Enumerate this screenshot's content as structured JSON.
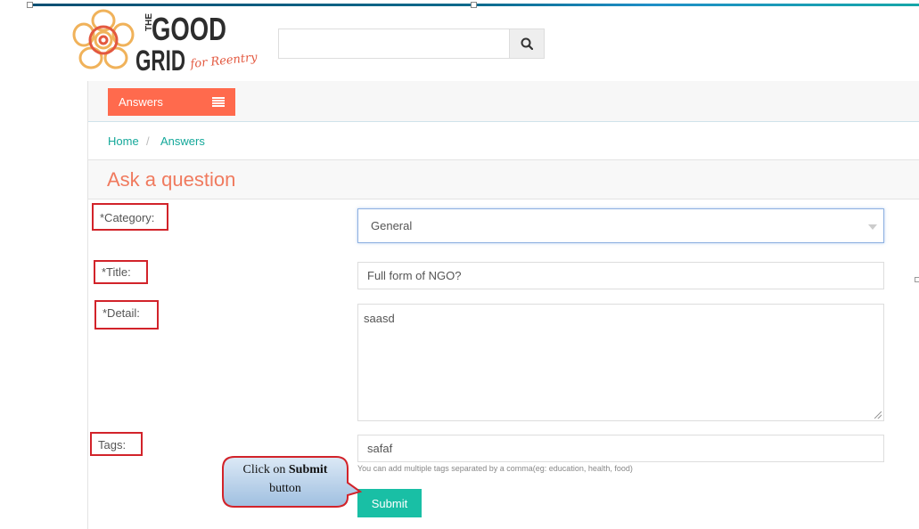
{
  "logo": {
    "line1": "THE",
    "line1b": "GOOD",
    "line2": "GRID",
    "tagline": "for Reentry"
  },
  "search": {
    "placeholder": "",
    "icon": "search-icon"
  },
  "toolbar": {
    "answers_label": "Answers",
    "menu_icon": "menu-icon"
  },
  "breadcrumb": {
    "home": "Home",
    "separator": "/",
    "current": "Answers"
  },
  "page": {
    "title": "Ask a question"
  },
  "form": {
    "category": {
      "label": "*Category:",
      "value": "General"
    },
    "title": {
      "label": "*Title:",
      "value": "Full form of NGO?"
    },
    "detail": {
      "label": "*Detail:",
      "value": "saasd"
    },
    "tags": {
      "label": "Tags:",
      "value": "safaf",
      "helper": "You can add multiple tags separated by a comma(eg: education, health, food)"
    },
    "submit_label": "Submit"
  },
  "callout": {
    "prefix": "Click on ",
    "bold": "Submit",
    "suffix": "button"
  },
  "colors": {
    "accent_orange": "#ff6a4d",
    "title_coral": "#f07a5e",
    "link_teal": "#14a89a",
    "submit_teal": "#19bfa5",
    "highlight_red": "#d2232a"
  }
}
